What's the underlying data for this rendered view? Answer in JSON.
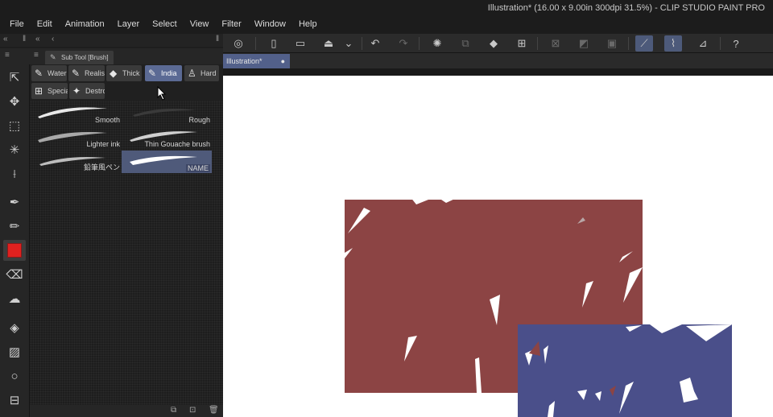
{
  "window": {
    "title": "Illustration* (16.00 x 9.00in 300dpi 31.5%) - CLIP STUDIO PAINT PRO"
  },
  "menubar": {
    "items": [
      "File",
      "Edit",
      "Animation",
      "Layer",
      "Select",
      "View",
      "Filter",
      "Window",
      "Help"
    ]
  },
  "command_bar": {
    "icons": [
      "clip-studio-icon",
      "new-file-icon",
      "open-file-icon",
      "save-icon",
      "dropdown-icon",
      "undo-icon",
      "redo-icon",
      "loading-icon",
      "copy-icon",
      "fill-icon",
      "crop-icon",
      "clear-icon",
      "fill-layer-icon",
      "border-icon",
      "pen-pressure-icon",
      "brush-pressure-icon",
      "ruler-snap-icon",
      "help-icon"
    ]
  },
  "sub_tool_panel": {
    "tab_label": "Sub Tool [Brush]",
    "groups": [
      {
        "label": "Watercolor",
        "icon": "watercolor-brush-icon",
        "active": false
      },
      {
        "label": "Realistic",
        "icon": "realistic-brush-icon",
        "active": false
      },
      {
        "label": "Thick",
        "icon": "thick-paint-icon",
        "active": false
      },
      {
        "label": "India",
        "icon": "india-ink-icon",
        "active": true
      },
      {
        "label": "Hard",
        "icon": "hard-brush-icon",
        "active": false
      },
      {
        "label": "Special",
        "icon": "special-brush-icon",
        "active": false
      },
      {
        "label": "Destroy",
        "icon": "destroy-brush-icon",
        "active": false
      }
    ],
    "brushes": [
      {
        "label": "Smooth",
        "selected": false
      },
      {
        "label": "Rough",
        "selected": false
      },
      {
        "label": "Lighter ink",
        "selected": false
      },
      {
        "label": "Thin Gouache brush",
        "selected": false
      },
      {
        "label": "鉛筆風ペン",
        "selected": false
      },
      {
        "label": "NAME",
        "selected": true
      }
    ]
  },
  "tools": [
    "operation-tool-icon",
    "move-tool-icon",
    "selection-tool-icon",
    "auto-select-icon",
    "eyedropper-icon",
    "pen-tool-icon",
    "pencil-tool-icon",
    "brush-tool-icon",
    "eraser-icon",
    "blend-tool-icon",
    "fill-tool-icon",
    "gradient-icon",
    "figure-tool-icon",
    "frame-border-icon"
  ],
  "document": {
    "tab_label": "Illustration*",
    "modified_marker": "●"
  },
  "colors": {
    "accent": "#5b6a94",
    "main_color": "#e0211f",
    "shape_red": "#8c4444",
    "shape_blue": "#4a4f8a"
  }
}
